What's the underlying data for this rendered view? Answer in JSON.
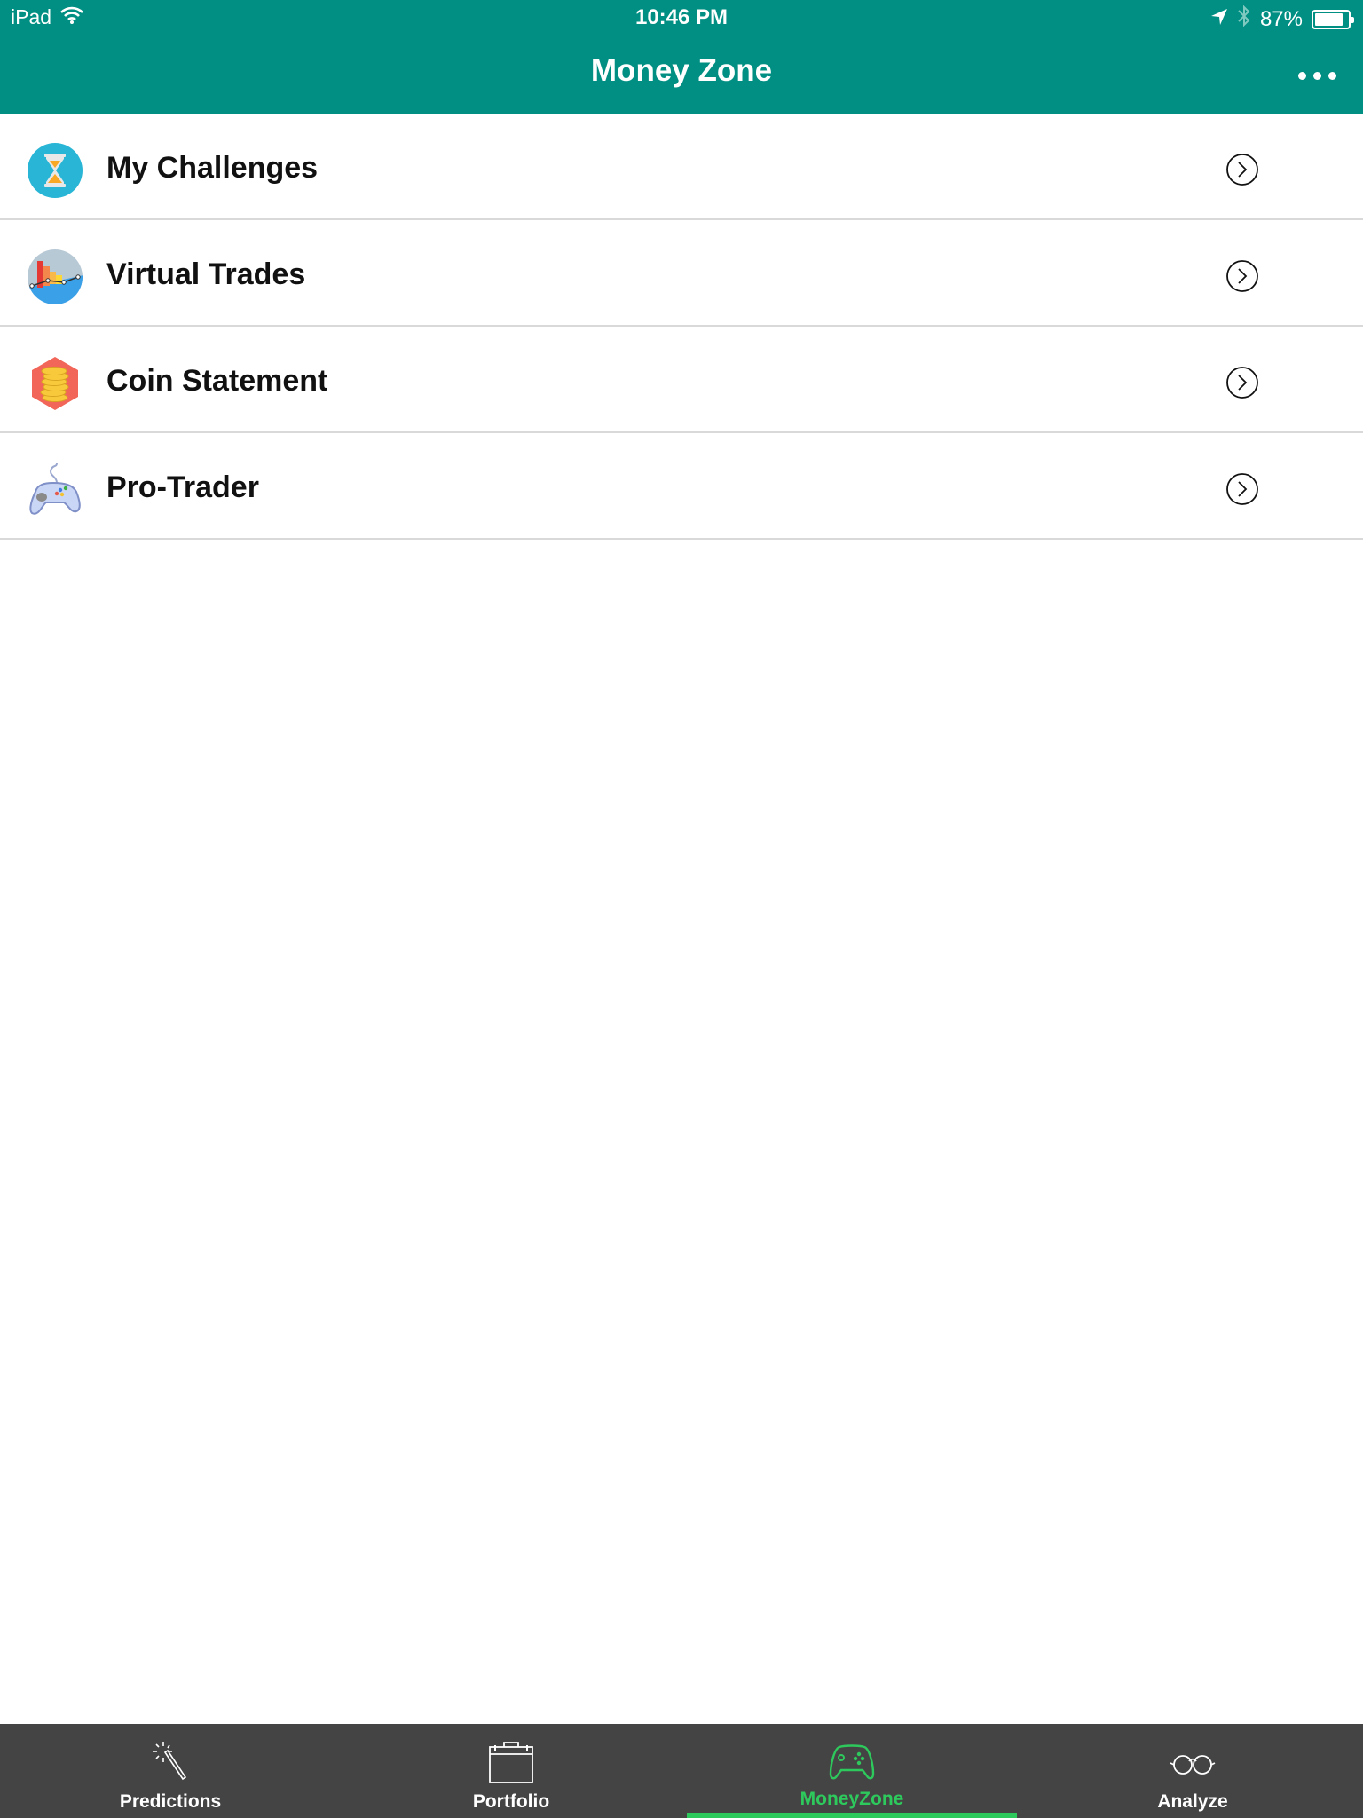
{
  "status_bar": {
    "device": "iPad",
    "time": "10:46 PM",
    "battery_percent_label": "87%",
    "battery_level": 0.87,
    "icons": [
      "wifi-icon",
      "location-arrow-icon",
      "bluetooth-icon",
      "battery-icon"
    ]
  },
  "nav": {
    "title": "Money Zone",
    "more_icon": "ellipsis-icon"
  },
  "menu": {
    "items": [
      {
        "label": "My Challenges",
        "icon": "hourglass-icon"
      },
      {
        "label": "Virtual Trades",
        "icon": "bar-chart-icon"
      },
      {
        "label": "Coin Statement",
        "icon": "coins-icon"
      },
      {
        "label": "Pro-Trader",
        "icon": "gamepad-icon"
      }
    ],
    "chevron_icon": "chevron-right-circle-icon"
  },
  "tabbar": {
    "active_color": "#2ec95c",
    "tabs": [
      {
        "label": "Predictions",
        "icon": "magic-wand-icon",
        "active": false
      },
      {
        "label": "Portfolio",
        "icon": "briefcase-icon",
        "active": false
      },
      {
        "label": "MoneyZone",
        "icon": "game-controller-icon",
        "active": true
      },
      {
        "label": "Analyze",
        "icon": "glasses-icon",
        "active": false
      }
    ]
  },
  "colors": {
    "header_bg": "#008f82",
    "tabbar_bg": "#444444",
    "divider": "#d9d9d9"
  }
}
